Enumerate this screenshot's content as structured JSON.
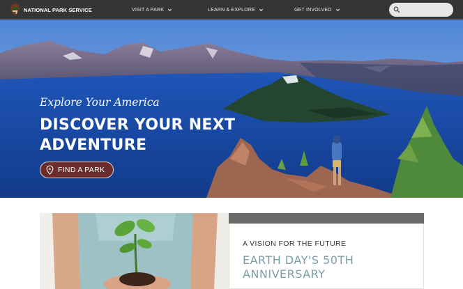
{
  "nav": {
    "brand": "NATIONAL PARK SERVICE",
    "items": [
      {
        "label": "VISIT A PARK"
      },
      {
        "label": "LEARN & EXPLORE"
      },
      {
        "label": "GET INVOLVED"
      }
    ],
    "search_placeholder": ""
  },
  "hero": {
    "eyebrow": "Explore Your America",
    "title": "DISCOVER YOUR NEXT ADVENTURE",
    "button_label": "FIND A PARK"
  },
  "feature": {
    "kicker": "A VISION FOR THE FUTURE",
    "title": "EARTH DAY'S 50TH ANNIVERSARY"
  },
  "colors": {
    "nav_bg": "#353535",
    "button_bg": "#6b2c2c",
    "feature_title": "#7a9ea8",
    "feature_bar": "#6a6a6a"
  },
  "icons": [
    "nps-arrowhead-icon",
    "chevron-down-icon",
    "search-icon",
    "map-pin-icon"
  ]
}
